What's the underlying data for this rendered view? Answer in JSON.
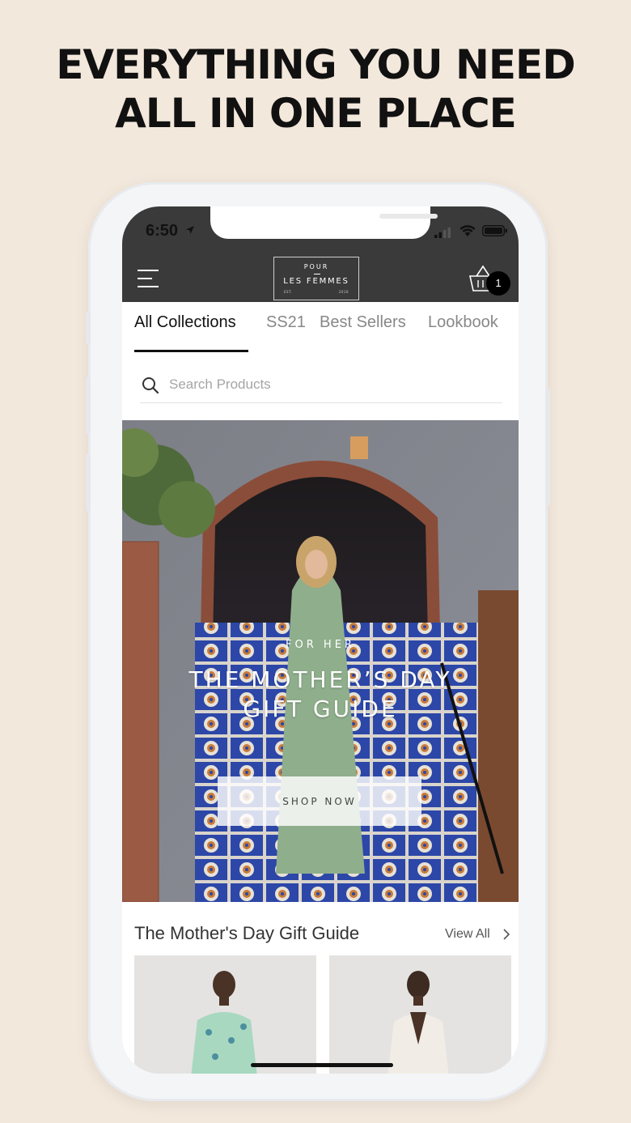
{
  "headline": {
    "line1": "EVERYTHING YOU NEED",
    "line2": "ALL IN ONE PLACE"
  },
  "status_bar": {
    "time": "6:50",
    "icons": [
      "location-arrow-icon",
      "cellular-signal-icon",
      "wifi-icon",
      "battery-icon"
    ]
  },
  "app_bar": {
    "menu_icon": "hamburger-menu-icon",
    "logo": {
      "top": "POUR",
      "main": "LES FEMMES",
      "est": "EST.",
      "year": "2016"
    },
    "cart_icon": "shopping-basket-icon",
    "cart_count": "1"
  },
  "tabs": [
    {
      "label": "All Collections",
      "active": true
    },
    {
      "label": "SS21",
      "active": false
    },
    {
      "label": "Best Sellers",
      "active": false
    },
    {
      "label": "Lookbook",
      "active": false
    }
  ],
  "search": {
    "placeholder": "Search Products",
    "icon": "search-icon"
  },
  "hero": {
    "kicker": "FOR HER",
    "title_line1": "THE MOTHER’S DAY",
    "title_line2": "GIFT GUIDE",
    "cta": "SHOP NOW"
  },
  "section": {
    "title": "The Mother's Day Gift Guide",
    "view_all": "View All"
  },
  "colors": {
    "background": "#f3e8dc",
    "app_bar": "#3a3a3a",
    "text_dark": "#111111",
    "text_muted": "#888888"
  }
}
